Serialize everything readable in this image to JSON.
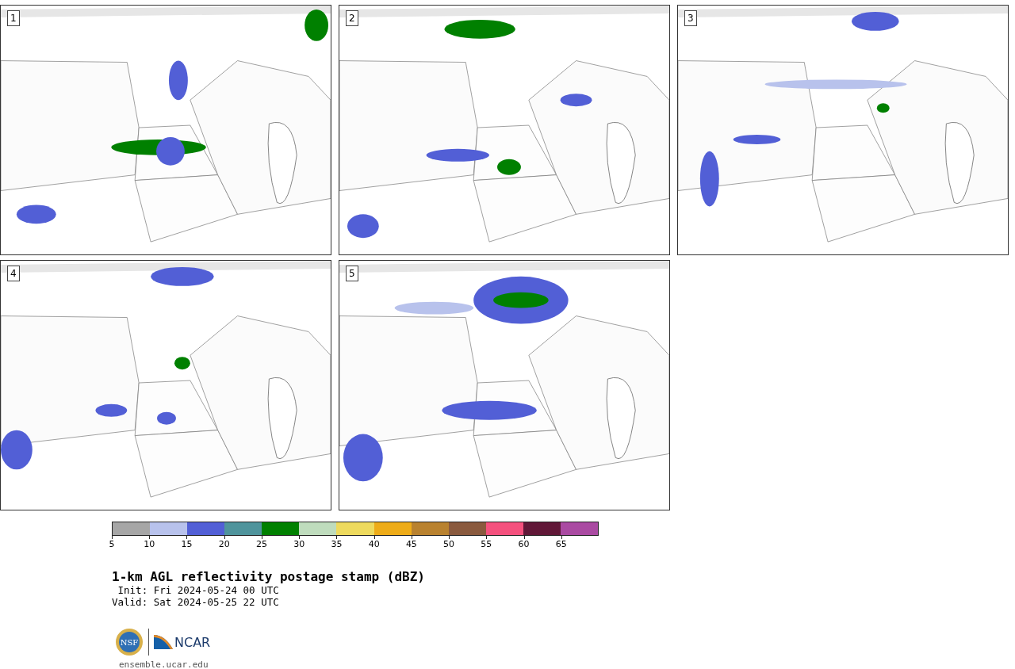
{
  "panels": [
    {
      "number": "1"
    },
    {
      "number": "2"
    },
    {
      "number": "3"
    },
    {
      "number": "4"
    },
    {
      "number": "5"
    }
  ],
  "colorbar": {
    "segments": [
      {
        "color": "#a6a6a6",
        "tick": "5"
      },
      {
        "color": "#b8c2ec",
        "tick": "10"
      },
      {
        "color": "#525fd6",
        "tick": "15"
      },
      {
        "color": "#4f949c",
        "tick": "20"
      },
      {
        "color": "#008000",
        "tick": "25"
      },
      {
        "color": "#bfdcbd",
        "tick": "30"
      },
      {
        "color": "#eeda5e",
        "tick": "35"
      },
      {
        "color": "#eeac19",
        "tick": "40"
      },
      {
        "color": "#b9822f",
        "tick": "45"
      },
      {
        "color": "#8a5a3e",
        "tick": "50"
      },
      {
        "color": "#f5517e",
        "tick": "55"
      },
      {
        "color": "#611838",
        "tick": "60"
      },
      {
        "color": "#aa4aa2",
        "tick": "65"
      }
    ]
  },
  "title": "1-km AGL reflectivity postage stamp (dBZ)",
  "init": " Init: Fri 2024-05-24 00 UTC",
  "valid": "Valid: Sat 2024-05-25 22 UTC",
  "logos": {
    "nsf": "NSF",
    "ncar": "NCAR"
  },
  "url": "ensemble.ucar.edu"
}
